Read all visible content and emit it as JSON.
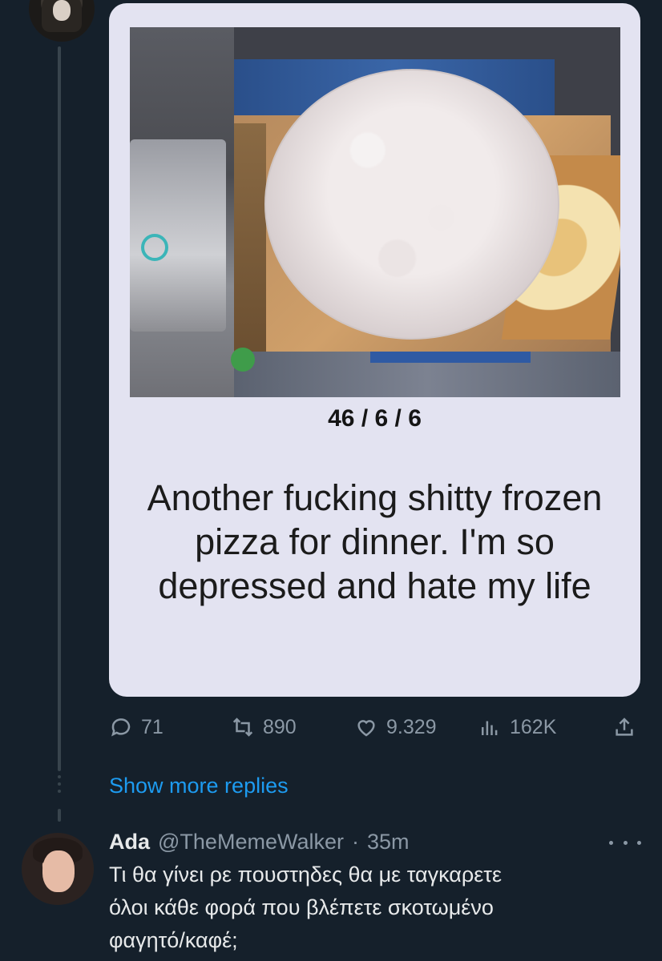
{
  "card": {
    "date": "46 / 6 / 6",
    "text": "Another fucking shitty frozen pizza for dinner. I'm so depressed and hate my life"
  },
  "actions": {
    "replies": "71",
    "retweets": "890",
    "likes": "9.329",
    "views": "162K"
  },
  "show_more_label": "Show more replies",
  "reply": {
    "name": "Ada",
    "handle": "@TheMemeWalker",
    "separator": "·",
    "time": "35m",
    "text": "Τι θα γίνει ρε πουστηδες θα με ταγκαρετε\nόλοι κάθε φορά που βλέπετε σκοτωμένο\nφαγητό/καφέ;"
  },
  "colors": {
    "background": "#15202b",
    "accent": "#1d9bf0",
    "muted": "#8b98a5",
    "text": "#e7e9ea"
  },
  "icons": [
    "reply-icon",
    "retweet-icon",
    "like-icon",
    "views-icon",
    "share-icon",
    "more-icon"
  ]
}
